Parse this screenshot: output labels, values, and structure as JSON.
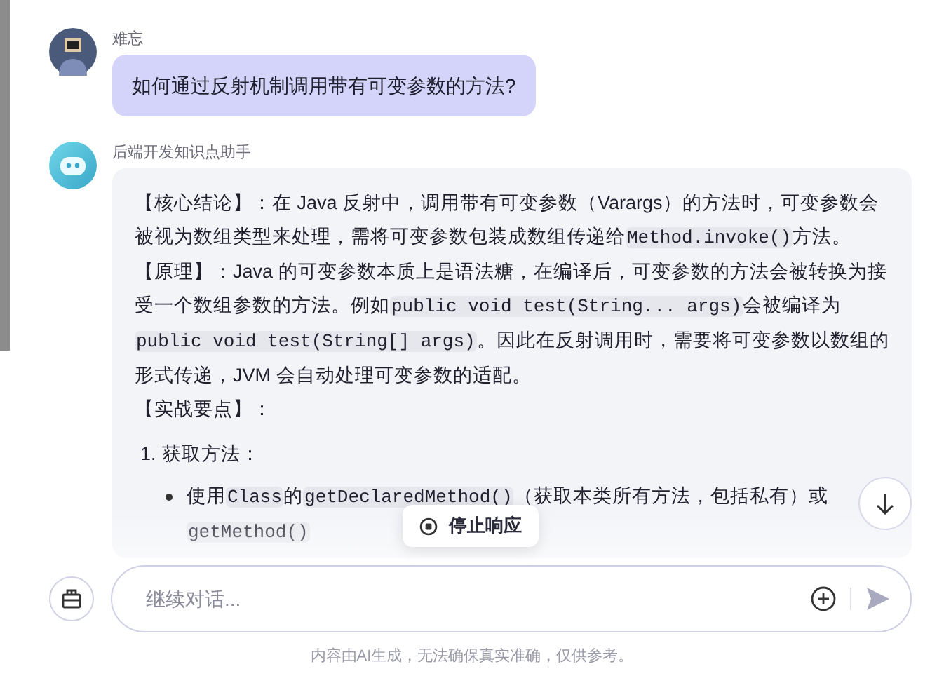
{
  "messages": [
    {
      "kind": "user",
      "sender": "难忘",
      "text": "如何通过反射机制调用带有可变参数的方法?"
    },
    {
      "kind": "assistant",
      "sender": "后端开发知识点助手",
      "blocks": [
        {
          "kind": "paragraph",
          "segments": [
            {
              "kind": "text",
              "text": "【核心结论】：在 Java 反射中，调用带有可变参数（Varargs）的方法时，可变参数会被视为数组类型来处理，需将可变参数包装成数组传递给"
            },
            {
              "kind": "code",
              "text": "Method.invoke()"
            },
            {
              "kind": "text",
              "text": "方法。"
            }
          ]
        },
        {
          "kind": "paragraph",
          "segments": [
            {
              "kind": "text",
              "text": "【原理】：Java 的可变参数本质上是语法糖，在编译后，可变参数的方法会被转换为接受一个数组参数的方法。例如"
            },
            {
              "kind": "code",
              "text": "public void test(String... args)"
            },
            {
              "kind": "text",
              "text": "会被编译为"
            },
            {
              "kind": "code",
              "text": "public void test(String[] args)"
            },
            {
              "kind": "text",
              "text": "。因此在反射调用时，需要将可变参数以数组的形式传递，JVM 会自动处理可变参数的适配。"
            }
          ]
        },
        {
          "kind": "paragraph",
          "segments": [
            {
              "kind": "text",
              "text": "【实战要点】："
            }
          ]
        },
        {
          "kind": "ordered",
          "number": "1.",
          "title": "获取方法：",
          "children": [
            {
              "kind": "bullet",
              "segments": [
                {
                  "kind": "text",
                  "text": "使用"
                },
                {
                  "kind": "code",
                  "text": "Class"
                },
                {
                  "kind": "text",
                  "text": "的"
                },
                {
                  "kind": "code",
                  "text": "getDeclaredMethod()"
                },
                {
                  "kind": "text",
                  "text": "（获取本类所有方法，包括私有）或"
                },
                {
                  "kind": "code",
                  "text": "getMethod()"
                }
              ]
            }
          ]
        }
      ]
    }
  ],
  "stop_button": {
    "label": "停止响应"
  },
  "composer": {
    "placeholder": "继续对话..."
  },
  "footer_note": "内容由AI生成，无法确保真实准确，仅供参考。"
}
